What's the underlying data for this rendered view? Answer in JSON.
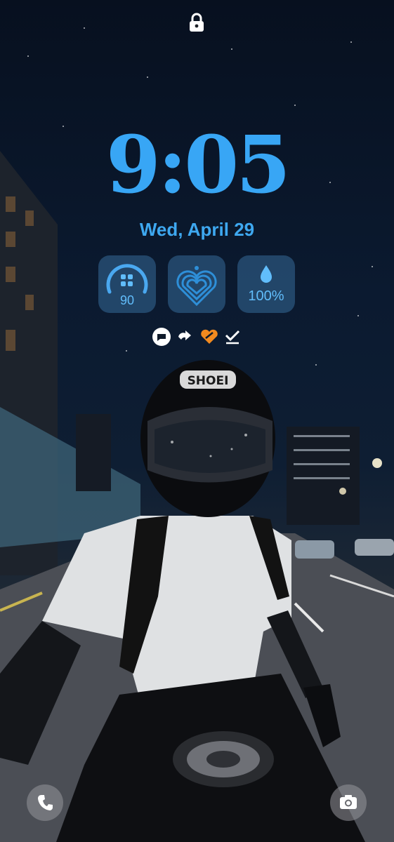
{
  "lockscreen": {
    "time": "9:05",
    "date": "Wed, April 29",
    "widgets": {
      "gauge_value": "90",
      "battery": "100%"
    },
    "notification_icons": [
      "chat-bubble-icon",
      "share-arrows-icon",
      "heart-app-icon",
      "checkmark-icon"
    ],
    "shortcuts": {
      "left": "phone-icon",
      "right": "camera-icon"
    },
    "accent_color": "#38a6f5",
    "widget_bg_color": "#3b6f9e"
  },
  "wallpaper": {
    "helmet_text": "SHOEI"
  }
}
